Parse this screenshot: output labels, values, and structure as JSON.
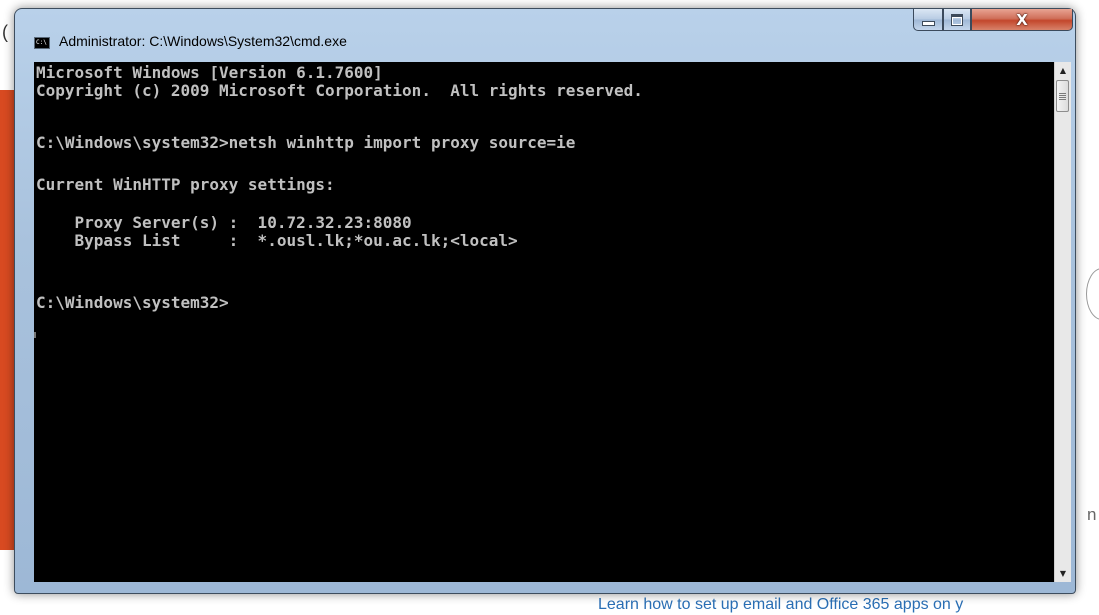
{
  "window": {
    "title": "Administrator: C:\\Windows\\System32\\cmd.exe",
    "icon": "cmd-icon",
    "icon_text": "C:\\",
    "minimize_icon": "minimize-icon",
    "maximize_icon": "maximize-icon",
    "close_icon": "close-icon",
    "close_glyph": "X"
  },
  "console": {
    "lines": [
      "Microsoft Windows [Version 6.1.7600]",
      "Copyright (c) 2009 Microsoft Corporation.  All rights reserved.",
      "",
      "C:\\Windows\\system32>netsh winhttp import proxy source=ie",
      "",
      "Current WinHTTP proxy settings:",
      "",
      "    Proxy Server(s) :  10.72.32.23:8080",
      "    Bypass List     :  *.ousl.lk;*ou.ac.lk;<local>",
      "",
      "",
      "C:\\Windows\\system32>"
    ],
    "foreground_color": "#c0c0c0",
    "background_color": "#000000"
  },
  "scrollbar": {
    "up_arrow": "▲",
    "down_arrow": "▼"
  },
  "background_page": {
    "left_char": "(",
    "right_char": "n",
    "bottom_link_text": "Learn how to set up email and Office 365 apps on y",
    "accent_color": "#d84a21",
    "link_color": "#2a6fb5"
  }
}
